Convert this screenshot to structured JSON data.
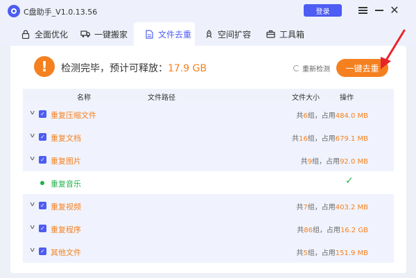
{
  "app": {
    "title": "C盘助手_V1.0.13.56",
    "login_label": "登录"
  },
  "tabs": [
    {
      "label": "全面优化",
      "icon": "lock-icon"
    },
    {
      "label": "一键搬家",
      "icon": "truck-icon"
    },
    {
      "label": "文件去重",
      "icon": "document-icon"
    },
    {
      "label": "空间扩容",
      "icon": "rocket-icon"
    },
    {
      "label": "工具箱",
      "icon": "toolbox-icon"
    }
  ],
  "status": {
    "prefix": "检测完毕，预计可释放：",
    "size": "17.9 GB"
  },
  "rescan_label": "重新检测",
  "dedupe_label": "一键去重",
  "table": {
    "headers": {
      "name": "名称",
      "path": "文件路径",
      "size": "文件大小",
      "action": "操作"
    },
    "rows": [
      {
        "name": "重复压缩文件",
        "prefix": "共",
        "groups": "6",
        "mid": "组，占用",
        "size": "484.0 MB",
        "checked": true
      },
      {
        "name": "重复文档",
        "prefix": "共",
        "groups": "16",
        "mid": "组，占用",
        "size": "679.1 MB",
        "checked": true
      },
      {
        "name": "重复图片",
        "prefix": "共",
        "groups": "9",
        "mid": "组，占用",
        "size": "92.0 MB",
        "checked": true
      },
      {
        "name": "重复音乐",
        "done": true
      },
      {
        "name": "重复视频",
        "prefix": "共",
        "groups": "7",
        "mid": "组，占用",
        "size": "403.2 MB",
        "checked": true
      },
      {
        "name": "重复程序",
        "prefix": "共",
        "groups": "86",
        "mid": "组，占用",
        "size": "16.2 GB",
        "checked": true
      },
      {
        "name": "其他文件",
        "prefix": "共",
        "groups": "5",
        "mid": "组，占用",
        "size": "151.9 MB",
        "checked": true
      }
    ]
  },
  "colors": {
    "accent": "#4d5cf2",
    "orange": "#f5801f",
    "green": "#22b14c"
  }
}
